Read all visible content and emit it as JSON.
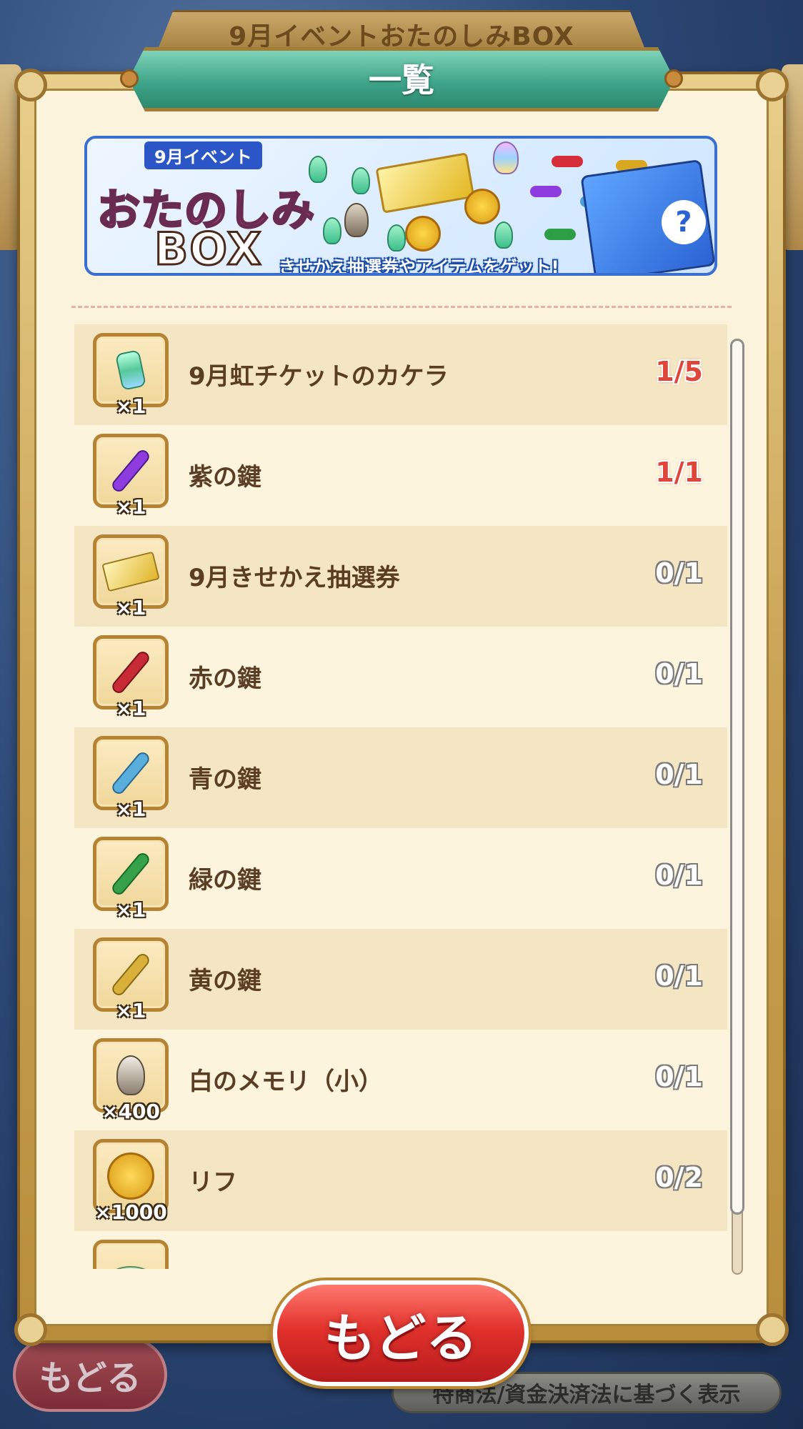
{
  "background": {
    "title": "9月イベントおたのしみBOX",
    "back_label": "もどる",
    "legal_label": "特商法/資金決済法に基づく表示"
  },
  "header": {
    "title": "一覧"
  },
  "banner": {
    "tag": "9月イベント",
    "logo_line1": "おたのしみ",
    "logo_line2": "BOX",
    "caption": "きせかえ抽選券やアイテムをゲット!"
  },
  "items": [
    {
      "icon": "ticket-fragment-icon",
      "name": "9月虹チケットのカケラ",
      "qty": "×1",
      "count": "1/5",
      "highlight": true
    },
    {
      "icon": "purple-key-icon",
      "name": "紫の鍵",
      "qty": "×1",
      "count": "1/1",
      "highlight": true
    },
    {
      "icon": "gold-ticket-icon",
      "name": "9月きせかえ抽選券",
      "qty": "×1",
      "count": "0/1",
      "highlight": false
    },
    {
      "icon": "red-key-icon",
      "name": "赤の鍵",
      "qty": "×1",
      "count": "0/1",
      "highlight": false
    },
    {
      "icon": "blue-key-icon",
      "name": "青の鍵",
      "qty": "×1",
      "count": "0/1",
      "highlight": false
    },
    {
      "icon": "green-key-icon",
      "name": "緑の鍵",
      "qty": "×1",
      "count": "0/1",
      "highlight": false
    },
    {
      "icon": "yellow-key-icon",
      "name": "黄の鍵",
      "qty": "×1",
      "count": "0/1",
      "highlight": false
    },
    {
      "icon": "white-memory-icon",
      "name": "白のメモリ（小）",
      "qty": "×400",
      "count": "0/1",
      "highlight": false
    },
    {
      "icon": "rif-coin-icon",
      "name": "リフ",
      "qty": "×1000",
      "count": "0/2",
      "highlight": false
    },
    {
      "icon": "partial-item-icon",
      "name": "",
      "qty": "",
      "count": "",
      "highlight": false
    }
  ],
  "back_button": {
    "label": "もどる"
  },
  "colors": {
    "highlight_count": "#e0453a",
    "header_green": "#3fa58a",
    "frame_gold": "#b58331",
    "back_red": "#e2322c"
  }
}
